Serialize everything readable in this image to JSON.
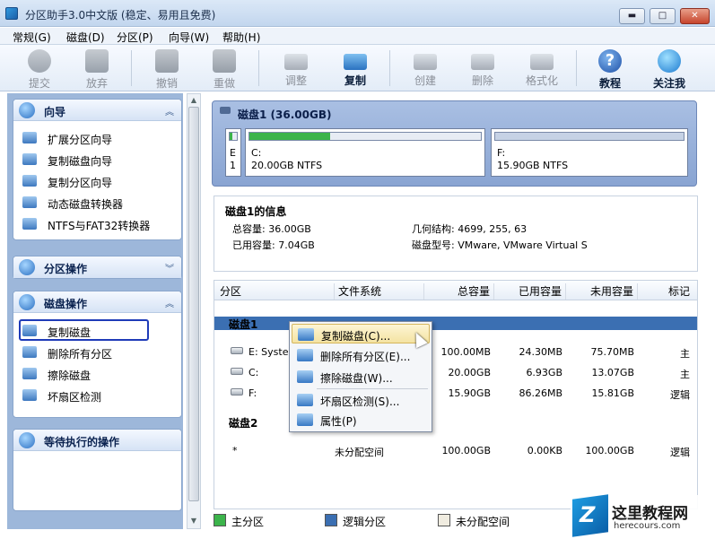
{
  "window": {
    "title": "分区助手3.0中文版 (稳定、易用且免费)",
    "min": "▬",
    "max": "□",
    "close": "✕"
  },
  "menu": [
    "常规(G)",
    "磁盘(D)",
    "分区(P)",
    "向导(W)",
    "帮助(H)"
  ],
  "toolbar": {
    "commit": "提交",
    "discard": "放弃",
    "undo": "撤销",
    "redo": "重做",
    "adjust": "调整",
    "copy": "复制",
    "create": "创建",
    "delete": "删除",
    "format": "格式化",
    "tutorial": "教程",
    "follow": "关注我"
  },
  "sidebar": {
    "wizard": {
      "title": "向导",
      "items": [
        "扩展分区向导",
        "复制磁盘向导",
        "复制分区向导",
        "动态磁盘转换器",
        "NTFS与FAT32转换器"
      ]
    },
    "partition_ops": {
      "title": "分区操作"
    },
    "disk_ops": {
      "title": "磁盘操作",
      "items": [
        "复制磁盘",
        "删除所有分区",
        "擦除磁盘",
        "坏扇区检测"
      ]
    },
    "pending": {
      "title": "等待执行的操作"
    }
  },
  "disk_map": {
    "title": "磁盘1 (36.00GB)",
    "e_letter": "E",
    "e_num": "1",
    "c_label": "C:",
    "c_size": "20.00GB NTFS",
    "f_label": "F:",
    "f_size": "15.90GB NTFS",
    "c_used_fraction": 0.35,
    "f_used_fraction": 0.0
  },
  "info": {
    "title": "磁盘1的信息",
    "total": "总容量: 36.00GB",
    "used": "已用容量: 7.04GB",
    "geometry": "几何结构: 4699, 255, 63",
    "model": "磁盘型号: VMware, VMware Virtual S"
  },
  "table": {
    "headers": [
      "分区",
      "文件系统",
      "总容量",
      "已用容量",
      "未用容量",
      "标记"
    ],
    "group1": "磁盘1",
    "rows": [
      {
        "part": "E:  Syste",
        "fs": "",
        "total": "100.00MB",
        "used": "24.30MB",
        "free": "75.70MB",
        "flag": "主"
      },
      {
        "part": "C:",
        "fs": "",
        "total": "20.00GB",
        "used": "6.93GB",
        "free": "13.07GB",
        "flag": "主"
      },
      {
        "part": "F:",
        "fs": "",
        "total": "15.90GB",
        "used": "86.26MB",
        "free": "15.81GB",
        "flag": "逻辑"
      }
    ],
    "group2": "磁盘2",
    "row_disk2": {
      "part": "*",
      "fs": "未分配空间",
      "total": "100.00GB",
      "used": "0.00KB",
      "free": "100.00GB",
      "flag": "逻辑"
    }
  },
  "context_menu": [
    "复制磁盘(C)...",
    "删除所有分区(E)...",
    "擦除磁盘(W)...",
    "坏扇区检测(S)...",
    "属性(P)"
  ],
  "legend": {
    "primary": "主分区",
    "logical": "逻辑分区",
    "unallocated": "未分配空间"
  },
  "watermark": {
    "line1": "这里教程网",
    "line2": "herecours.com"
  },
  "colors": {
    "primary": "#3cb44b",
    "logical": "#3b6fb2",
    "unallocated": "#f0ece0",
    "highlight": "#3b6fb2"
  }
}
